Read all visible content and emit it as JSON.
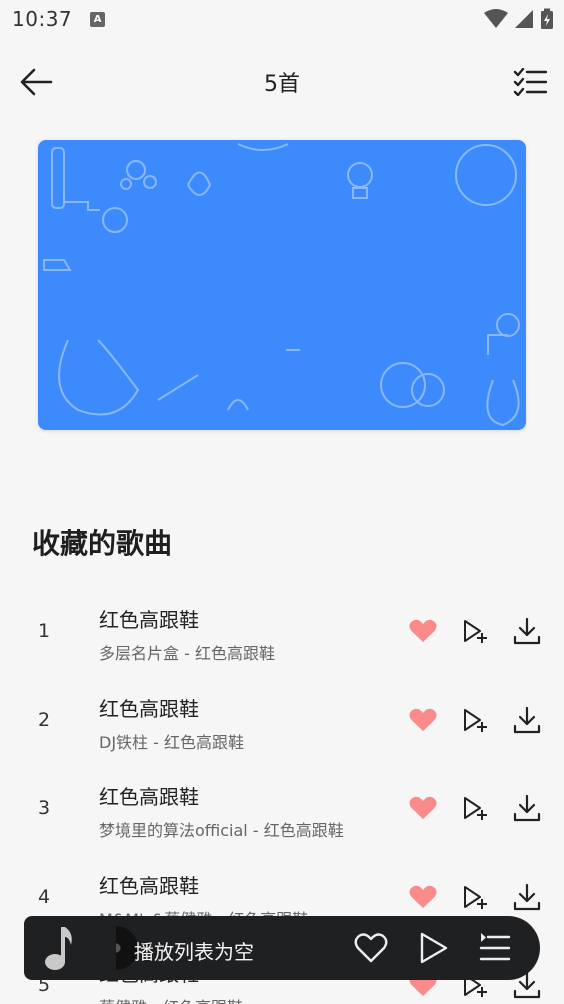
{
  "status_bar": {
    "time": "10:37",
    "notification_icon": "A"
  },
  "app_bar": {
    "title": "5首",
    "back_icon": "arrow-left-icon",
    "multi_select_icon": "checklist-icon"
  },
  "section": {
    "title": "收藏的歌曲"
  },
  "songs": [
    {
      "index": "1",
      "title": "红色高跟鞋",
      "subtitle": "多层名片盒 - 红色高跟鞋"
    },
    {
      "index": "2",
      "title": "红色高跟鞋",
      "subtitle": "DJ铁柱 - 红色高跟鞋"
    },
    {
      "index": "3",
      "title": "红色高跟鞋",
      "subtitle": "梦境里的算法official - 红色高跟鞋"
    },
    {
      "index": "4",
      "title": "红色高跟鞋",
      "subtitle": "M&M's&蔡健雅 - 红色高跟鞋"
    },
    {
      "index": "5",
      "title": "红色高跟鞋",
      "subtitle": "蔡健雅 - 红色高跟鞋"
    }
  ],
  "mini_player": {
    "text": "播放列表为空"
  },
  "colors": {
    "heart": "#fb8a8a",
    "cover": "#3d8afc",
    "player_bg": "#1f2022"
  }
}
